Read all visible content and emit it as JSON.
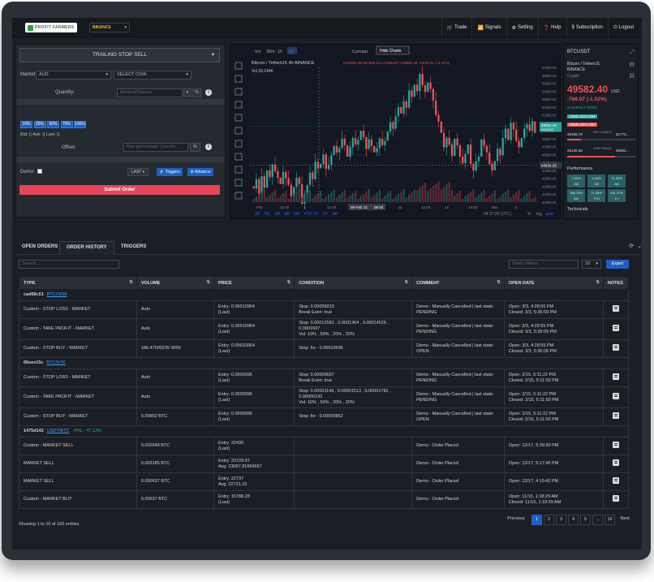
{
  "topbar": {
    "logo_text": "PROFIT FARMERS",
    "exchange": "BINANCE",
    "nav": [
      {
        "icon": "cart-icon",
        "glyph": "🛒",
        "label": "Trade"
      },
      {
        "icon": "wifi-icon",
        "glyph": "📶",
        "label": "Signals"
      },
      {
        "icon": "gear-icon",
        "glyph": "⚙",
        "label": "Setting"
      },
      {
        "icon": "help-icon",
        "glyph": "❓",
        "label": "Help"
      },
      {
        "icon": "dollar-icon",
        "glyph": "$",
        "label": "Subscription"
      },
      {
        "icon": "logout-icon",
        "glyph": "⏻",
        "label": "Logout"
      }
    ]
  },
  "order_form": {
    "order_type": "TRAILING STOP SELL",
    "market_label": "Market:",
    "market_value": "AUD",
    "coin_value": "SELECT COIN",
    "quantity_label": "Quantity:",
    "quantity_placeholder": "Amount/Volume",
    "percent_unit": "%",
    "percent_buttons": [
      "10%",
      "25%",
      "50%",
      "75%",
      "100%"
    ],
    "bid_ask_last": "Bid: || Ask: || Last: ||",
    "offset_label": "Offset:",
    "offset_placeholder": "Max percentage Loss fro",
    "demo_label": "Demo:",
    "last_select": "LAST",
    "triggers_label": "Triggers",
    "advance_label": "Advance",
    "submit_label": "Submit Order"
  },
  "chart": {
    "timeframes_top": [
      "1m",
      "30m",
      "1h",
      "4h"
    ],
    "active_tf": "4h",
    "compare_label": "Compar",
    "hide_charts": "Hide Charts",
    "symbol_line": "Bitcoin / TetherUS  4h  BINANCE",
    "ohlc": "O47505.39  H47928.23  L47506.57  C49582.40  +2075.01 (+4.37%)",
    "volume": "Vol  20.244K",
    "price_ticks": [
      "57000.00",
      "56000.00",
      "55000.00",
      "54000.00",
      "53000.00",
      "52000.00",
      "51000.00",
      "50000.00",
      "49000.00",
      "48000.00",
      "47000.00",
      "46000.00",
      "45000.00",
      "44000.00",
      "43000.00",
      "42000.00",
      "41000.00",
      "40000.00"
    ],
    "last_price_tag": "49582.40",
    "last_price_time": "04:00:00",
    "cross_price_tag": "44634.29",
    "time_ticks": [
      "Feb",
      "12:00",
      "4",
      "12:00",
      "09 Feb '21",
      "08:00",
      "15",
      "12:00",
      "22",
      "12:00",
      "Mar",
      "5"
    ],
    "ranges": [
      "1D",
      "5D",
      "1M",
      "3M",
      "6M",
      "YTD",
      "1Y",
      "5Y",
      "All"
    ],
    "clock": "04:37:29 (UTC)",
    "scale_opts": [
      "%",
      "log",
      "auto"
    ],
    "candles": [
      42,
      43,
      41,
      43,
      42,
      44,
      43,
      45,
      44,
      43,
      42,
      44,
      43,
      42,
      41,
      42,
      43,
      42,
      40,
      41,
      42,
      44,
      43,
      45,
      44,
      45,
      46,
      44,
      45,
      46,
      47,
      46,
      47,
      48,
      47,
      46,
      47,
      48,
      47,
      48,
      49,
      48,
      47,
      48,
      47,
      46,
      47,
      48,
      47,
      48,
      49,
      50,
      49,
      51,
      52,
      51,
      53,
      52,
      54,
      53,
      55,
      54,
      56,
      55,
      54,
      55,
      54,
      53,
      51,
      50,
      49,
      47,
      48,
      47,
      46,
      48,
      47,
      46,
      45,
      46,
      47,
      45,
      44,
      45,
      46,
      48,
      47,
      46,
      45,
      44,
      45,
      47,
      46,
      48,
      49,
      48,
      50,
      49,
      48,
      47,
      48,
      49,
      50,
      49,
      50,
      49
    ]
  },
  "ticker": {
    "symbol": "BTCUSDT",
    "name": "Bitcoin / TetherUS",
    "exchange": "BINANCE",
    "type": "Crypto",
    "price": "49582.40",
    "currency": "USD",
    "change": "-766.97 (-1.52%)",
    "status": "● MARKET OPEN",
    "bid": "49580.28×0.004",
    "ask": "49585.29×0.050",
    "day_low": "49358.78",
    "day_label": "DAY'S RANGE",
    "day_high": "51773...",
    "wk_low": "28136.68",
    "wk_label": "52WK RANGE",
    "wk_high": "58352...",
    "performance_label": "Performance",
    "perf": [
      {
        "v": "7.52%",
        "p": "1W"
      },
      {
        "v": "2.44%",
        "p": "1M"
      },
      {
        "v": "71.55%",
        "p": "3M"
      },
      {
        "v": "158.70%",
        "p": "6M"
      },
      {
        "v": "71.55%",
        "p": "YTD"
      },
      {
        "v": "441.37%",
        "p": "1Y"
      }
    ],
    "technicals_label": "Technicals"
  },
  "tabs": [
    "OPEN ORDERS",
    "ORDER HISTORY",
    "TRIGGERS"
  ],
  "active_tab": "ORDER HISTORY",
  "table": {
    "search_placeholder": "Search...",
    "filter_placeholder": "Select Filters",
    "page_size": "10",
    "export_label": "Export",
    "headers": [
      "TYPE",
      "VOLUME",
      "PRICE",
      "CONDITION",
      "COMMENT",
      "OPEN DATE",
      "NOTES"
    ],
    "groups": [
      {
        "id": "cad68c51",
        "pair": "BTC/SRM",
        "pnl": "",
        "rows": [
          {
            "type": "Custom - STOP LOSS - MARKET",
            "volume": "Auto",
            "price": [
              "Entry: 0.00010964",
              "(Last)"
            ],
            "condition": [
              "Stop: 0.00009223",
              "Break Even: true"
            ],
            "comment": [
              "Demo - Manually Cancelled | last state:",
              "PENDING"
            ],
            "date": [
              "Open: 3/3, 4:28:55 PM",
              "Closed: 3/3, 5:36:09 PM"
            ]
          },
          {
            "type": "Custom - TAKE PROFIT - MARKET",
            "volume": "Auto",
            "price": [
              "Entry: 0.00010964",
              "(Last)"
            ],
            "condition": [
              "Stop: 0.00012581 , 0.0001364 , 0.00014528 , 0.0001697",
              "Vol: 10% , 50% , 20% , 20%"
            ],
            "comment": [
              "Demo - Manually Cancelled | last state:",
              "PENDING"
            ],
            "date": [
              "Open: 3/3, 4:28:55 PM",
              "Closed: 3/3, 5:36:09 PM"
            ]
          },
          {
            "type": "Custom - STOP BUY - MARKET",
            "volume": "186.47090239 SRM",
            "price": [
              "Entry: 0.00010964",
              "(Last)"
            ],
            "condition": [
              "Stop: Ite - 0.00010596",
              ""
            ],
            "comment": [
              "Demo - Manually Cancelled | last state:",
              "OPEN"
            ],
            "date": [
              "Open: 3/3, 4:28:55 PM",
              "Closed: 3/3, 5:36:09 PM"
            ]
          }
        ]
      },
      {
        "id": "66eee15c",
        "pair": "BTC/STK",
        "pnl": "",
        "rows": [
          {
            "type": "Custom - STOP LOSS - MARKET",
            "volume": "Auto",
            "price": [
              "Entry: 0.0000096",
              "(Last)"
            ],
            "condition": [
              "Stop: 0.00000657",
              "Break Even: true"
            ],
            "comment": [
              "Demo - Manually Cancelled | last state:",
              "PENDING"
            ],
            "date": [
              "Open: 2/15, 5:11:22 PM",
              "Closed: 2/15, 5:11:50 PM"
            ]
          },
          {
            "type": "Custom - TAKE PROFIT - MARKET",
            "volume": "Auto",
            "price": [
              "Entry: 0.0000096",
              "(Last)"
            ],
            "condition": [
              "Stop: 0.00001149 , 0.00001513 , 0.00001782 , 0.00000192",
              "Vol: 10% , 50% , 20% , 20%"
            ],
            "comment": [
              "Demo - Manually Cancelled | last state:",
              "PENDING"
            ],
            "date": [
              "Open: 2/15, 5:11:22 PM",
              "Closed: 2/15, 5:11:50 PM"
            ]
          },
          {
            "type": "Custom - STOP BUY - MARKET",
            "volume": "0.00852 BTC",
            "price": [
              "Entry: 0.0000096",
              "(Last)"
            ],
            "condition": [
              "Stop: Ite - 0.00000852",
              ""
            ],
            "comment": [
              "Demo - Manually Cancelled | last state:",
              "OPEN"
            ],
            "date": [
              "Open: 2/15, 5:11:22 PM",
              "Closed: 2/15, 5:11:50 PM"
            ]
          }
        ]
      },
      {
        "id": "1475d142",
        "pair": "USDT/BTC",
        "pnl": "PNL : 47.12%",
        "rows": [
          {
            "type": "Custom - MARKET SELL",
            "volume": "0.002548 BTC",
            "price": [
              "Entry: 22430",
              "(Last)"
            ],
            "condition": [
              "",
              ""
            ],
            "comment": [
              "Demo - Order Placed",
              ""
            ],
            "date": [
              "Open: 12/17, 5:39:30 PM",
              ""
            ]
          },
          {
            "type": "MARKET SELL",
            "volume": "0.003185 BTC",
            "price": [
              "Entry: 23729.97",
              "Avg: 23057.81666667"
            ],
            "condition": [
              "",
              ""
            ],
            "comment": [
              "Demo - Order Placed",
              ""
            ],
            "date": [
              "Open: 12/17, 5:17:45 PM",
              ""
            ]
          },
          {
            "type": "MARKET SELL",
            "volume": "0.000637 BTC",
            "price": [
              "Entry: 22737",
              "Avg: 22721.15"
            ],
            "condition": [
              "",
              ""
            ],
            "comment": [
              "Demo - Order Placed",
              ""
            ],
            "date": [
              "Open: 12/17, 4:15:42 PM",
              ""
            ]
          },
          {
            "type": "Custom - MARKET BUY",
            "volume": "0.00637 BTC",
            "price": [
              "Entry: 15788.28",
              "(Last)"
            ],
            "condition": [
              "",
              ""
            ],
            "comment": [
              "Demo - Order Placed",
              ""
            ],
            "date": [
              "Open: 11/15, 1:18:29 AM",
              "Closed: 11/15, 1:18:29 AM"
            ]
          }
        ]
      }
    ],
    "footer": "Showing 1 to 10 of 160 entries",
    "pages": [
      "Previous",
      "1",
      "2",
      "3",
      "4",
      "5",
      "...",
      "16",
      "Next"
    ]
  }
}
